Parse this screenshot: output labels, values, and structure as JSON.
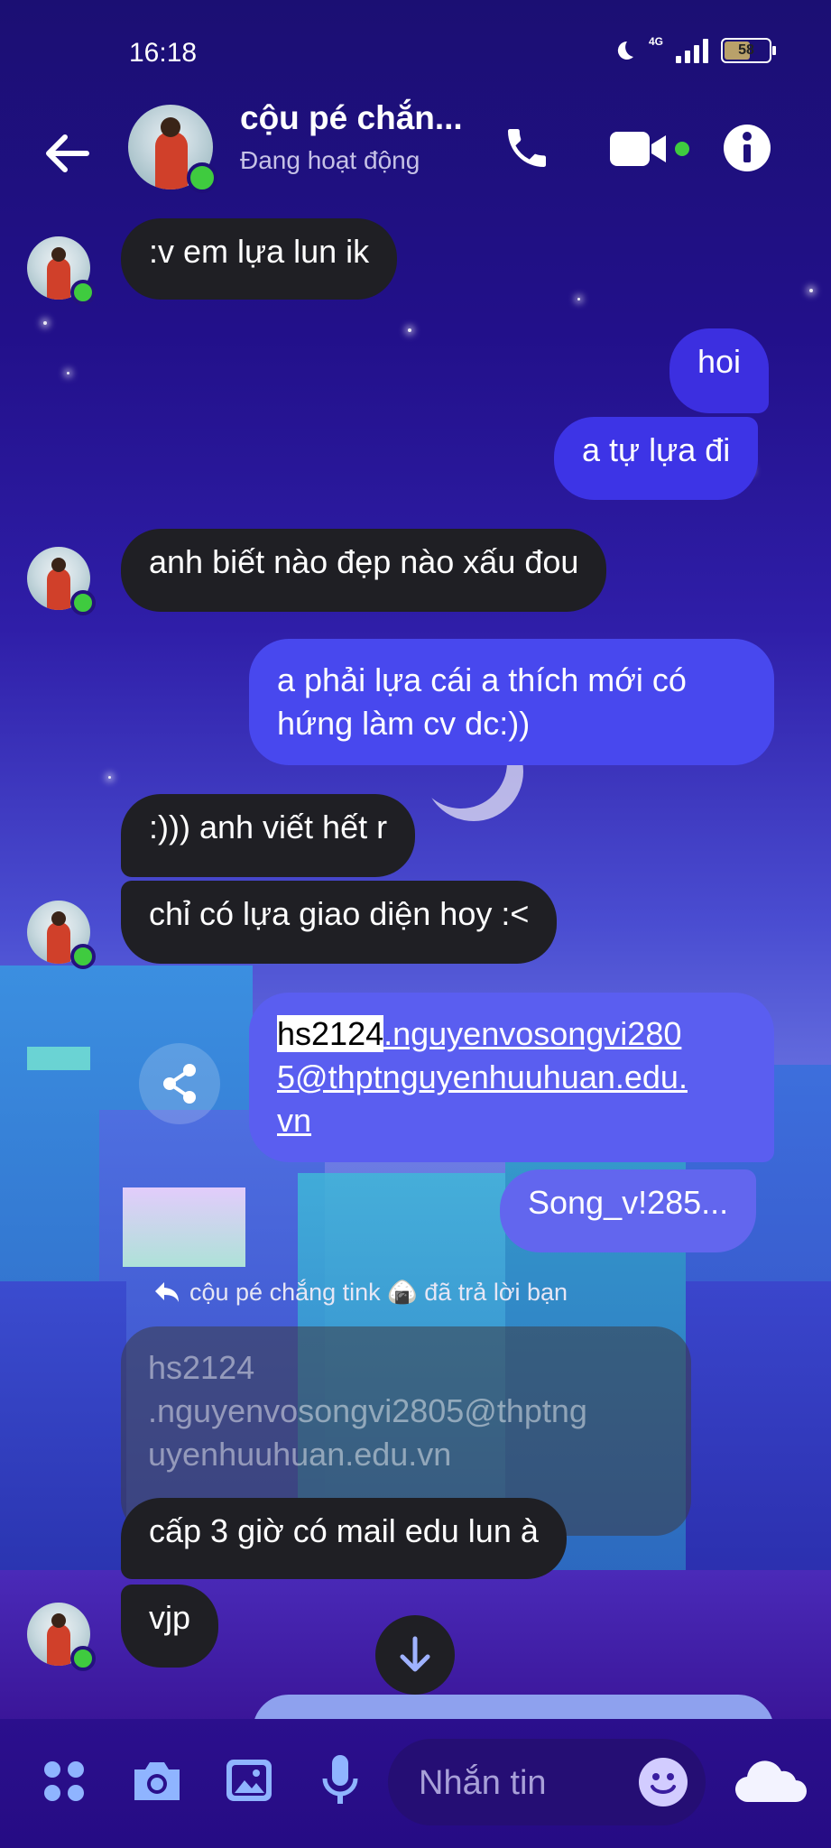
{
  "status_bar": {
    "time": "16:18",
    "network": "4G",
    "battery": "58"
  },
  "header": {
    "contact_name": "cộu pé chắn...",
    "presence": "Đang hoạt động"
  },
  "messages": {
    "m1": ":v em lựa lun ik",
    "m2": "hoi",
    "m3": "a tự lựa đi",
    "m4": "anh biết nào đẹp nào xấu đou",
    "m5_line1": "a phải lựa cái a thích mới có",
    "m5_line2": "hứng làm cv dc:))",
    "m6": ":))) anh viết hết r",
    "m7": "chỉ có lựa giao diện hoy :<",
    "m8_highlight": "hs2124",
    "m8_line1_rest": ".nguyenvosongvi280",
    "m8_line2": "5@thptnguyenhuuhuan.edu.",
    "m8_line3": "vn",
    "m9": "Song_v!285...",
    "reply_note": "cộu pé chắng tink 🍙 đã trả lời bạn",
    "quoted_line1": "hs2124",
    "quoted_line2": ".nguyenvosongvi2805@thptng",
    "quoted_line3": "uyenhuuhuan.edu.vn",
    "m10": "cấp 3 giờ có mail edu lun à",
    "m11": "vjp"
  },
  "composer": {
    "placeholder": "Nhắn tin"
  },
  "colors": {
    "accent": "#3c2dd8",
    "out_bubble_top": "#3c2fe0",
    "out_bubble_mid": "#4b4cf0",
    "out_bubble_low": "#5b62ee",
    "in_bubble": "#1f1f24",
    "online": "#3fcb3f"
  },
  "icons": [
    "back-arrow-icon",
    "phone-icon",
    "video-icon",
    "info-icon",
    "share-icon",
    "reply-icon",
    "arrow-down-icon",
    "apps-icon",
    "camera-icon",
    "image-icon",
    "mic-icon",
    "emoji-icon",
    "cloud-icon"
  ]
}
